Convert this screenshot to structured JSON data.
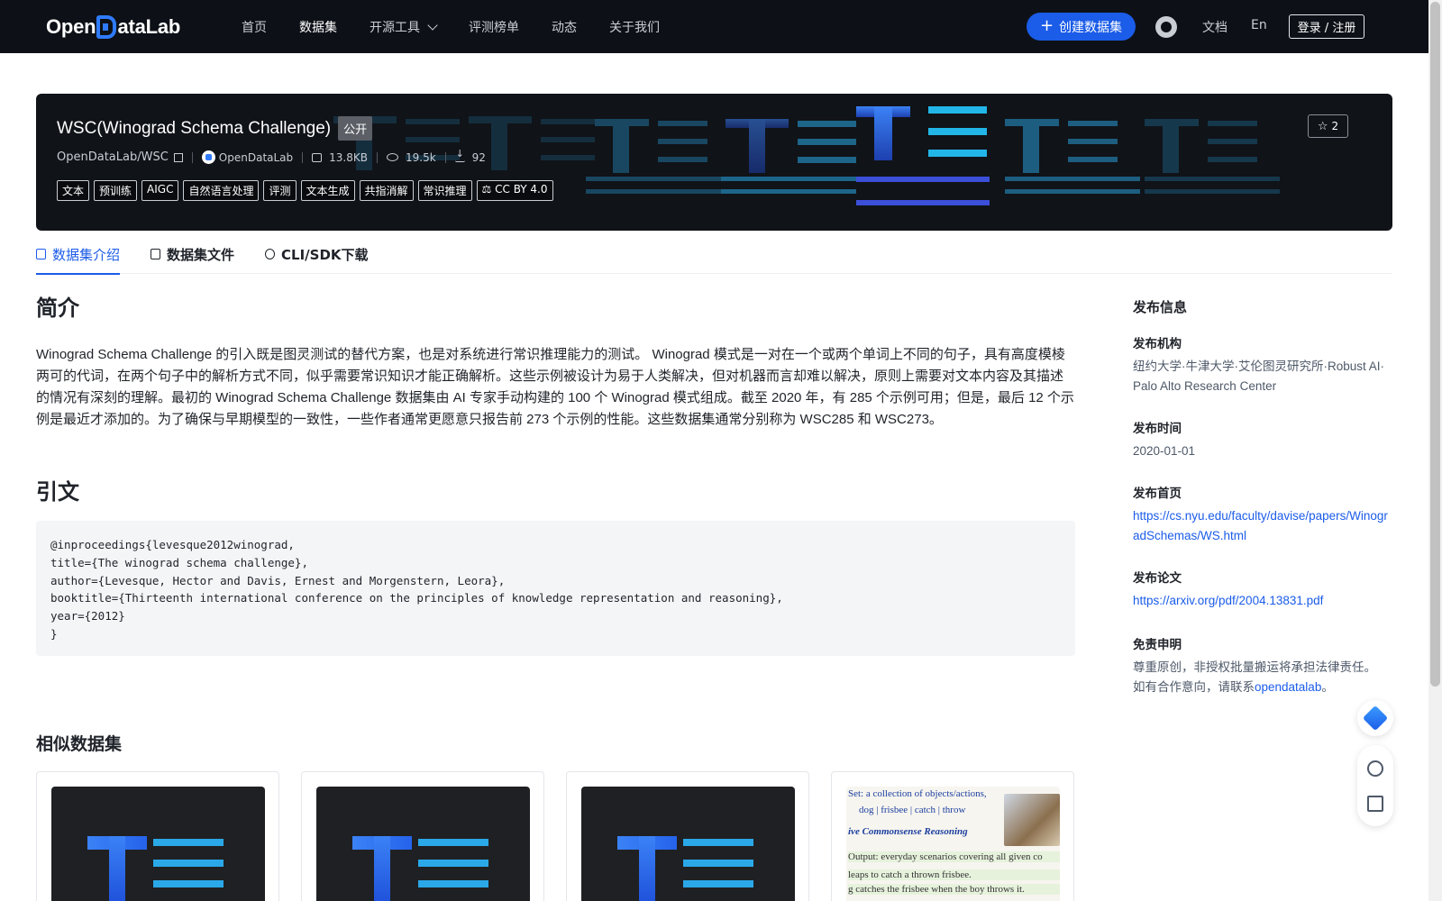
{
  "nav": {
    "logo_left": "Open",
    "logo_right": "ataLab",
    "items": [
      {
        "label": "首页"
      },
      {
        "label": "数据集"
      },
      {
        "label": "开源工具"
      },
      {
        "label": "评测榜单"
      },
      {
        "label": "动态"
      },
      {
        "label": "关于我们"
      }
    ],
    "create_label": "创建数据集",
    "docs_label": "文档",
    "lang_label": "En",
    "login_label": "登录 / 注册"
  },
  "dataset": {
    "title": "WSC(Winograd Schema Challenge)",
    "visibility": "公开",
    "path": "OpenDataLab/WSC",
    "org": "OpenDataLab",
    "size": "13.8KB",
    "views": "19.5k",
    "downloads": "92",
    "stars": "2",
    "tags": [
      "文本",
      "预训练",
      "AIGC",
      "自然语言处理",
      "评测",
      "文本生成",
      "共指消解",
      "常识推理"
    ],
    "license": "CC BY 4.0"
  },
  "tabs": [
    {
      "label": "数据集介绍"
    },
    {
      "label": "数据集文件"
    },
    {
      "label": "CLI/SDK下载"
    }
  ],
  "intro": {
    "heading": "简介",
    "text": "Winograd Schema Challenge 的引入既是图灵测试的替代方案，也是对系统进行常识推理能力的测试。 Winograd 模式是一对在一个或两个单词上不同的句子，具有高度模棱两可的代词，在两个句子中的解析方式不同，似乎需要常识知识才能正确解析。这些示例被设计为易于人类解决，但对机器而言却难以解决，原则上需要对文本内容及其描述的情况有深刻的理解。最初的 Winograd Schema Challenge 数据集由 AI 专家手动构建的 100 个 Winograd 模式组成。截至 2020 年，有 285 个示例可用；但是，最后 12 个示例是最近才添加的。为了确保与早期模型的一致性，一些作者通常更愿意只报告前 273 个示例的性能。这些数据集通常分别称为 WSC285 和 WSC273。"
  },
  "citation": {
    "heading": "引文",
    "code": "@inproceedings{levesque2012winograd,\ntitle={The winograd schema challenge},\nauthor={Levesque, Hector and Davis, Ernest and Morgenstern, Leora},\nbooktitle={Thirteenth international conference on the principles of knowledge representation and reasoning},\nyear={2012}\n}"
  },
  "similar": {
    "heading": "相似数据集",
    "paper_lines": [
      "Set: a collection of objects/actions,",
      "dog | frisbee | catch | throw",
      "ive Commonsense Reasoning",
      "Output: everyday scenarios covering all given co",
      "leaps to catch a thrown frisbee.",
      "g catches the frisbee when the boy throws it."
    ]
  },
  "sidebar": {
    "title": "发布信息",
    "org_label": "发布机构",
    "org_value": "纽约大学·牛津大学·艾伦图灵研究所·Robust AI·Palo Alto Research Center",
    "date_label": "发布时间",
    "date_value": "2020-01-01",
    "home_label": "发布首页",
    "home_value": "https://cs.nyu.edu/faculty/davise/papers/WinogradSchemas/WS.html",
    "paper_label": "发布论文",
    "paper_value": "https://arxiv.org/pdf/2004.13831.pdf",
    "disclaimer_label": "免责申明",
    "disclaimer_text": "尊重原创，非授权批量搬运将承担法律责任。如有合作意向，请联系",
    "disclaimer_link": "opendatalab",
    "disclaimer_end": "。"
  },
  "colors": {
    "nav_bg": "#0d1117",
    "accent": "#1b5ce8",
    "banner_bg": "#101318"
  }
}
